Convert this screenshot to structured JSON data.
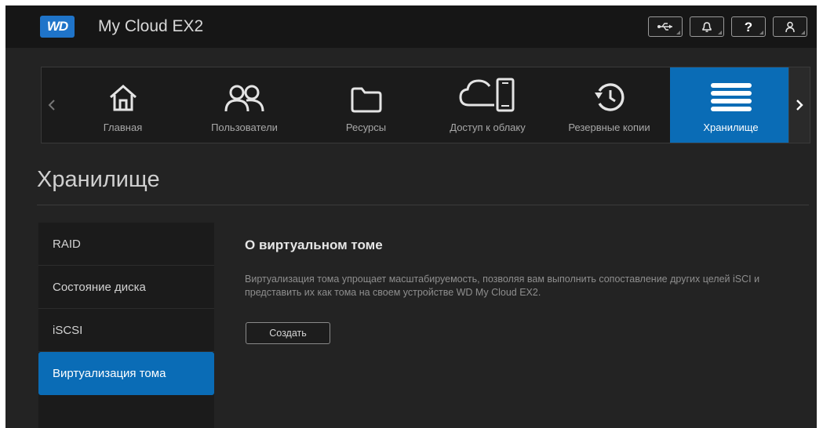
{
  "app": {
    "logo_text": "WD",
    "title": "My Cloud EX2",
    "brand_color": "#1f74c9",
    "accent_color": "#0a6cb6"
  },
  "top_icons": [
    "usb-icon",
    "bell-icon",
    "help-icon",
    "user-icon"
  ],
  "top_icon_labels": {
    "help": "?"
  },
  "nav": {
    "items": [
      {
        "label": "Главная",
        "icon": "home-icon"
      },
      {
        "label": "Пользователи",
        "icon": "users-icon"
      },
      {
        "label": "Ресурсы",
        "icon": "folder-icon"
      },
      {
        "label": "Доступ к облаку",
        "icon": "cloud-device-icon"
      },
      {
        "label": "Резервные копии",
        "icon": "history-icon"
      },
      {
        "label": "Хранилище",
        "icon": "storage-icon",
        "active": true
      }
    ]
  },
  "page": {
    "title": "Хранилище"
  },
  "sidebar": {
    "items": [
      {
        "label": "RAID"
      },
      {
        "label": "Состояние диска"
      },
      {
        "label": "iSCSI"
      },
      {
        "label": "Виртуализация тома",
        "active": true
      }
    ]
  },
  "content": {
    "heading": "О виртуальном томе",
    "description": "Виртуализация тома упрощает масштабируемость, позволяя вам выполнить сопоставление других целей iSCI и представить их как тома на своем устройстве WD My Cloud EX2.",
    "create_label": "Создать"
  }
}
